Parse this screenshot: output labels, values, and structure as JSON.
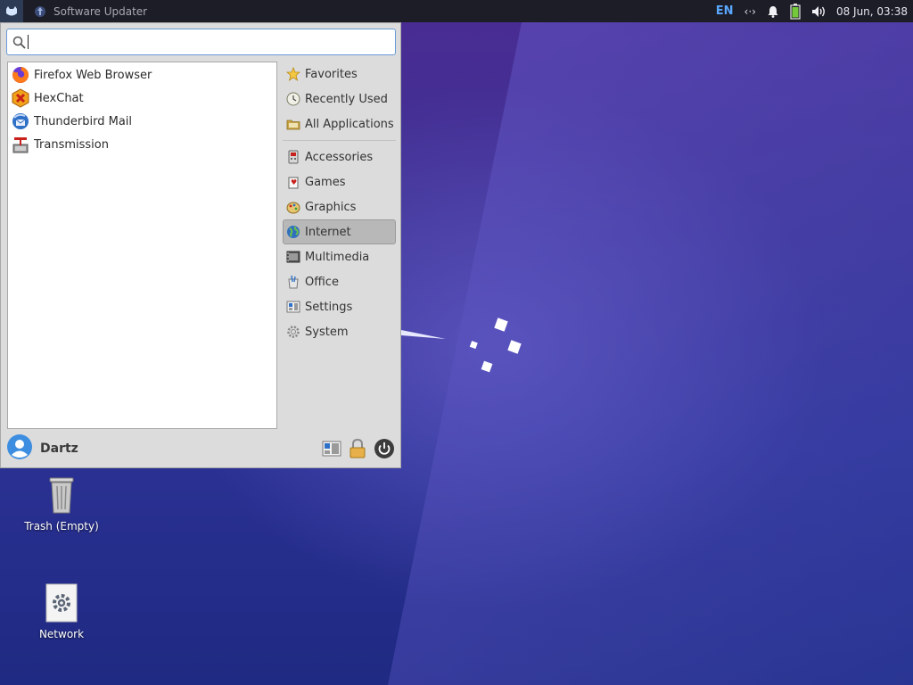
{
  "top_panel": {
    "taskbar_title": "Software Updater",
    "language": "EN",
    "network_glyph": "‹·›",
    "clock": "08 Jun, 03:38"
  },
  "menu": {
    "search": {
      "value": "",
      "placeholder": ""
    },
    "apps": [
      {
        "label": "Firefox Web Browser",
        "icon": "firefox-icon"
      },
      {
        "label": "HexChat",
        "icon": "hexchat-icon"
      },
      {
        "label": "Thunderbird Mail",
        "icon": "thunderbird-icon"
      },
      {
        "label": "Transmission",
        "icon": "transmission-icon"
      }
    ],
    "categories_top": [
      {
        "label": "Favorites",
        "icon": "star-icon"
      },
      {
        "label": "Recently Used",
        "icon": "clock-icon"
      },
      {
        "label": "All Applications",
        "icon": "folder-icon"
      }
    ],
    "categories": [
      {
        "label": "Accessories",
        "icon": "accessories-icon"
      },
      {
        "label": "Games",
        "icon": "games-icon"
      },
      {
        "label": "Graphics",
        "icon": "graphics-icon"
      },
      {
        "label": "Internet",
        "icon": "globe-icon",
        "active": true
      },
      {
        "label": "Multimedia",
        "icon": "multimedia-icon"
      },
      {
        "label": "Office",
        "icon": "office-icon"
      },
      {
        "label": "Settings",
        "icon": "settings-icon"
      },
      {
        "label": "System",
        "icon": "system-icon"
      }
    ],
    "user": {
      "name": "Dartz"
    }
  },
  "desktop": {
    "icons": [
      {
        "label": "Trash (Empty)",
        "icon": "trash-icon"
      },
      {
        "label": "Network",
        "icon": "network-icon"
      }
    ]
  },
  "colors": {
    "accent": "#5aa7ff",
    "panel": "#1d1d27",
    "menu_bg": "#dcdcdc",
    "active_category": "#b8b8b8"
  }
}
